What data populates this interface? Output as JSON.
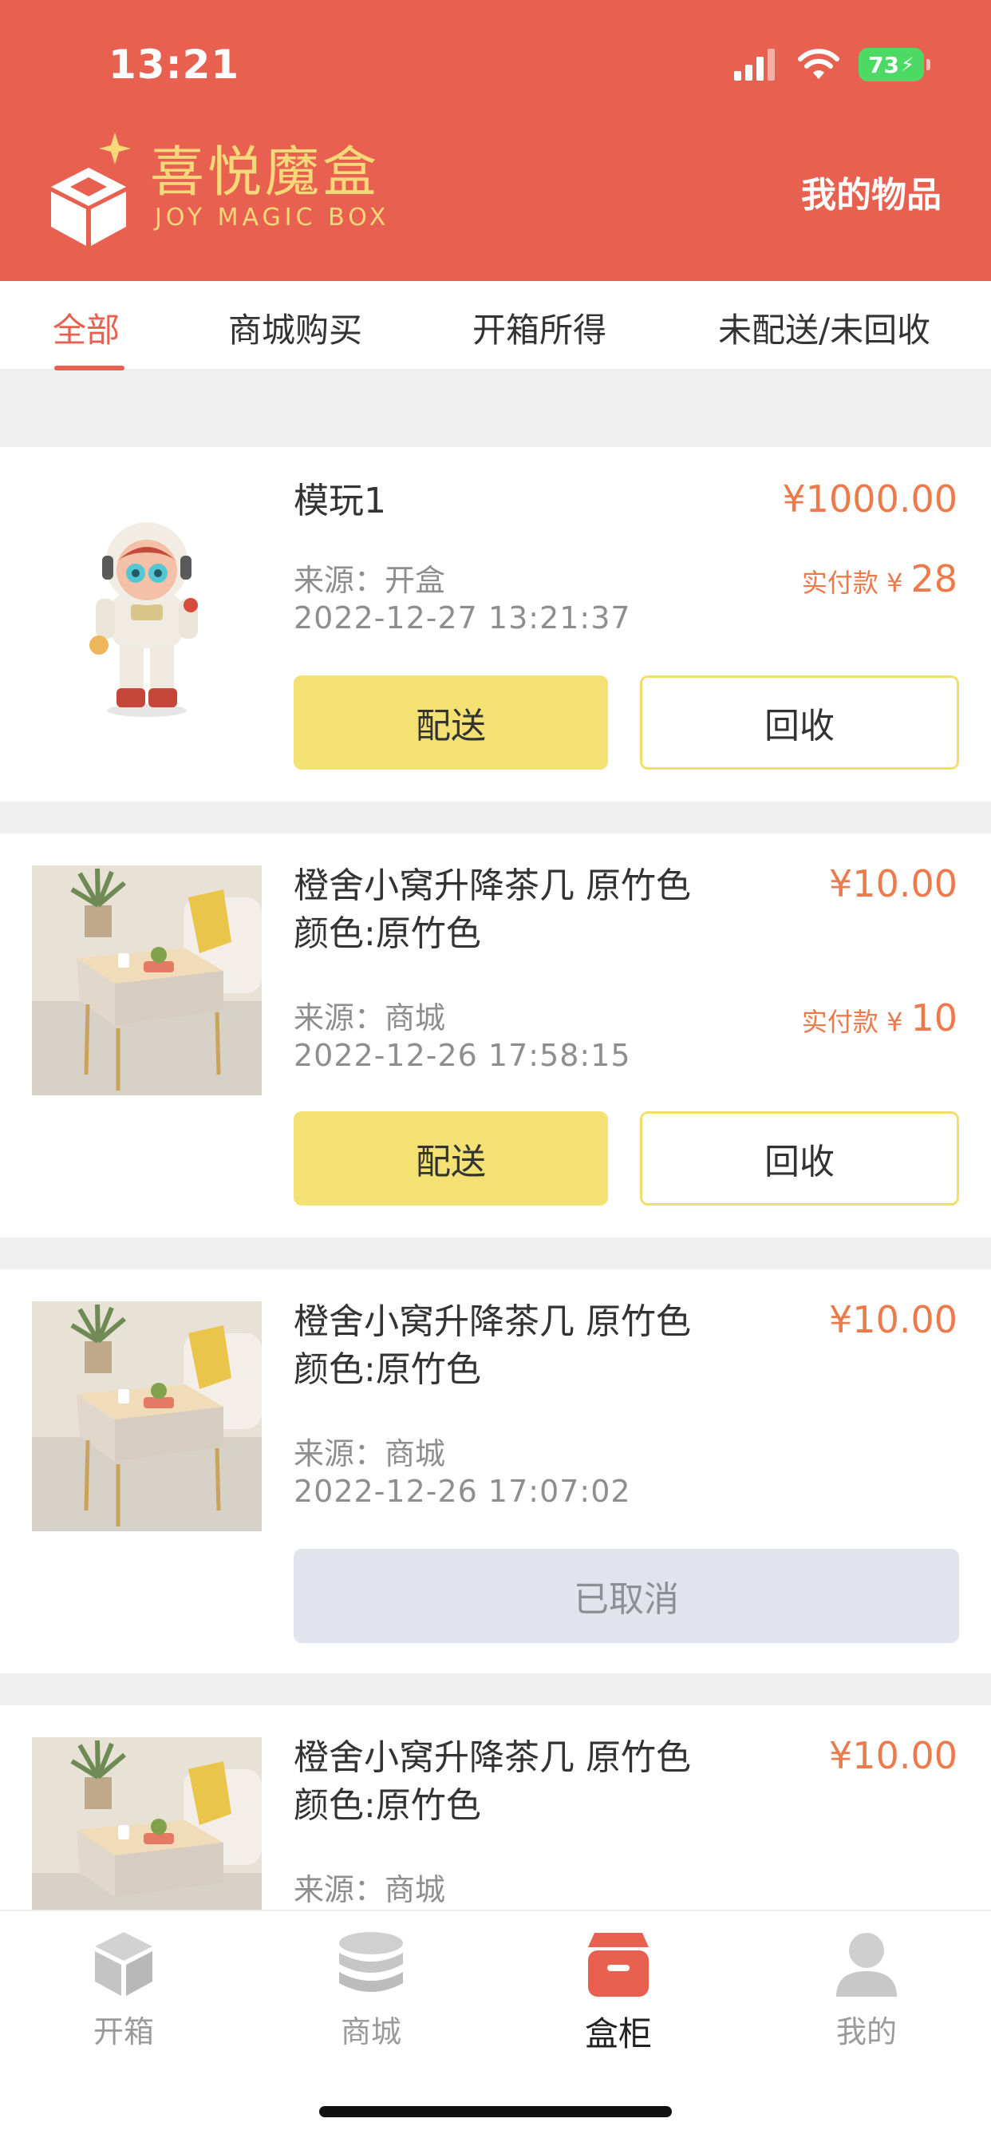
{
  "status_bar": {
    "time": "13:21",
    "battery": "73"
  },
  "header": {
    "logo_cn": "喜悦魔盒",
    "logo_en": "JOY MAGIC BOX",
    "title": "我的物品"
  },
  "tabs": [
    {
      "label": "全部",
      "active": true
    },
    {
      "label": "商城购买",
      "active": false
    },
    {
      "label": "开箱所得",
      "active": false
    },
    {
      "label": "未配送/未回收",
      "active": false
    }
  ],
  "items": [
    {
      "title": "模玩1",
      "price": "¥1000.00",
      "source": "来源：开盒",
      "date": "2022-12-27 13:21:37",
      "paid_label": "实付款 ¥",
      "paid_amount": "28",
      "deliver_label": "配送",
      "recycle_label": "回收",
      "image": "astronaut-figure"
    },
    {
      "title": "橙舍小窝升降茶几 原竹色",
      "spec": "颜色:原竹色",
      "price": "¥10.00",
      "source": "来源：商城",
      "date": "2022-12-26 17:58:15",
      "paid_label": "实付款 ¥",
      "paid_amount": "10",
      "deliver_label": "配送",
      "recycle_label": "回收",
      "image": "coffee-table"
    },
    {
      "title": "橙舍小窝升降茶几 原竹色",
      "spec": "颜色:原竹色",
      "price": "¥10.00",
      "source": "来源：商城",
      "date": "2022-12-26 17:07:02",
      "status_label": "已取消",
      "image": "coffee-table"
    },
    {
      "title": "橙舍小窝升降茶几 原竹色",
      "spec": "颜色:原竹色",
      "price": "¥10.00",
      "source": "来源：商城",
      "image": "coffee-table"
    }
  ],
  "bottom_nav": [
    {
      "label": "开箱",
      "icon": "cube-icon",
      "active": false
    },
    {
      "label": "商城",
      "icon": "coins-icon",
      "active": false
    },
    {
      "label": "盒柜",
      "icon": "cabinet-icon",
      "active": true
    },
    {
      "label": "我的",
      "icon": "user-icon",
      "active": false
    }
  ],
  "colors": {
    "brand": "#e8604f",
    "price": "#ec7a4a",
    "deliver": "#f4e173",
    "logo": "#f5d87a"
  }
}
